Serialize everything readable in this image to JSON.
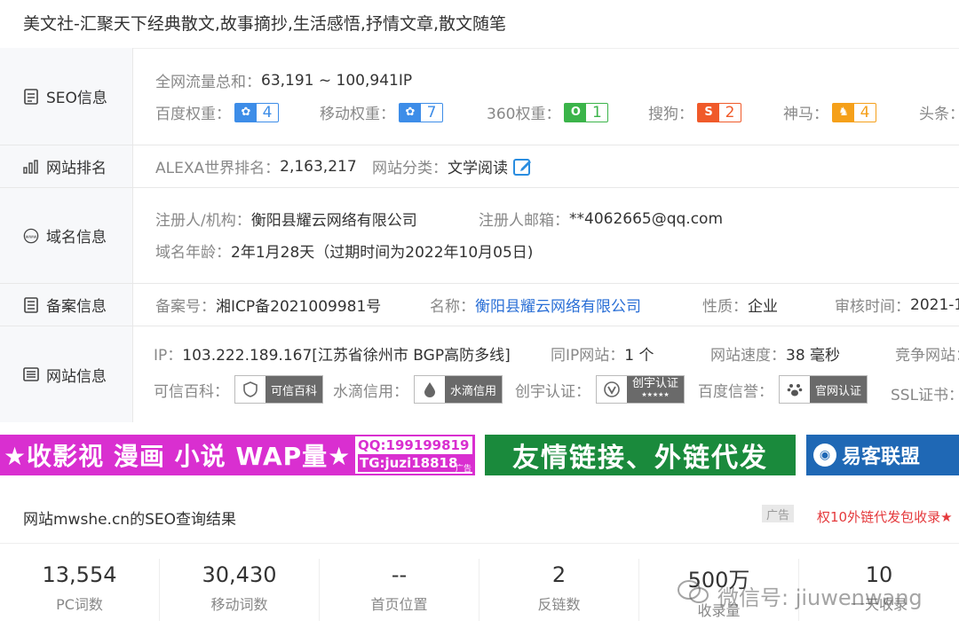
{
  "page_title": "美文社-汇聚天下经典散文,故事摘抄,生活感悟,抒情文章,散文随笔",
  "seo": {
    "heading": "SEO信息",
    "traffic_label": "全网流量总和：",
    "traffic_value": "63,191 ~ 100,941IP",
    "weights": [
      {
        "label": "百度权重：",
        "value": "4",
        "icon": "baidu-paw-icon",
        "color": "#3d8de8"
      },
      {
        "label": "移动权重：",
        "value": "7",
        "icon": "baidu-paw-icon",
        "color": "#3d8de8"
      },
      {
        "label": "360权重：",
        "value": "1",
        "icon": "360-icon",
        "color": "#3bb44a"
      },
      {
        "label": "搜狗：",
        "value": "2",
        "icon": "sogou-icon",
        "color": "#f05a2a"
      },
      {
        "label": "神马：",
        "value": "4",
        "icon": "shenma-icon",
        "color": "#f5a01a"
      },
      {
        "label": "头条："
      }
    ]
  },
  "rank": {
    "heading": "网站排名",
    "alexa_label": "ALEXA世界排名：",
    "alexa_value": "2,163,217",
    "category_label": "网站分类：",
    "category_value": "文学阅读"
  },
  "domain": {
    "heading": "域名信息",
    "registrant_label": "注册人/机构：",
    "registrant_value": "衡阳县耀云网络有限公司",
    "email_label": "注册人邮箱：",
    "email_value": "**4062665@qq.com",
    "age_label": "域名年龄：",
    "age_value": "2年1月28天（过期时间为2022年10月05日)"
  },
  "icp": {
    "heading": "备案信息",
    "number_label": "备案号：",
    "number_value": "湘ICP备2021009981号",
    "name_label": "名称：",
    "name_value": "衡阳县耀云网络有限公司",
    "nature_label": "性质：",
    "nature_value": "企业",
    "audit_label": "审核时间：",
    "audit_value": "2021-1"
  },
  "site": {
    "heading": "网站信息",
    "ip_label": "IP：",
    "ip_value": "103.222.189.167[江苏省徐州市 BGP高防多线]",
    "same_ip_label": "同IP网站：",
    "same_ip_value": "1 个",
    "speed_label": "网站速度：",
    "speed_value": "38 毫秒",
    "competitor_label": "竞争网站：",
    "trust": [
      {
        "label": "可信百科：",
        "badge": "可信百科",
        "icon": "shield-icon"
      },
      {
        "label": "水滴信用：",
        "badge": "水滴信用",
        "icon": "water-drop-icon"
      },
      {
        "label": "创宇认证：",
        "badge": "创宇认证",
        "badge_sub": "★★★★★",
        "icon": "v-check-icon"
      },
      {
        "label": "百度信誉：",
        "badge": "官网认证",
        "icon": "baidu-paw-icon"
      }
    ],
    "ssl_label": "SSL证书："
  },
  "ads": {
    "ad1_text": "★收影视 漫画 小说 WAP量★",
    "ad1_qq": "QQ:199199819",
    "ad1_tg": "TG:juzi18818",
    "ad1_tag": "广告",
    "ad2_text": "友情链接、外链代发",
    "ad3_text": "易客联盟"
  },
  "result": {
    "title": "网站mwshe.cn的SEO查询结果",
    "ad_label": "广告",
    "ad_link": "权10外链代发包收录★"
  },
  "stats": [
    {
      "num": "13,554",
      "cap": "PC词数"
    },
    {
      "num": "30,430",
      "cap": "移动词数"
    },
    {
      "num": "--",
      "cap": "首页位置"
    },
    {
      "num": "2",
      "cap": "反链数"
    },
    {
      "num": "500万",
      "cap": "收录量"
    },
    {
      "num": "10",
      "cap": "一天收录"
    }
  ],
  "watermark": "微信号: jiuwenwang"
}
